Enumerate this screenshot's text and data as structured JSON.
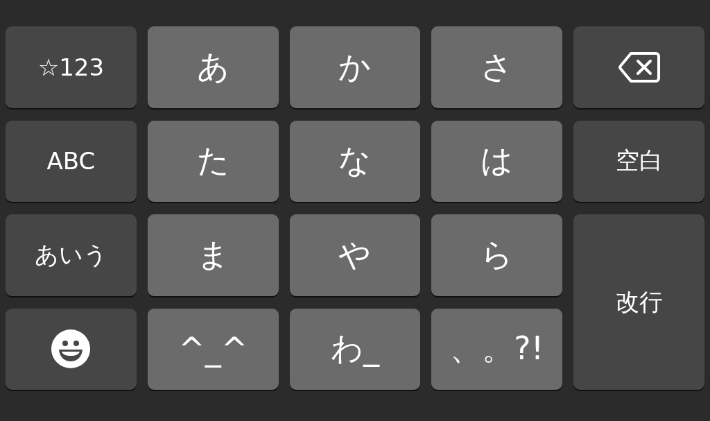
{
  "keys": [
    {
      "kind": "function",
      "label": "☆123"
    },
    {
      "kind": "char",
      "label": "あ"
    },
    {
      "kind": "char",
      "label": "か"
    },
    {
      "kind": "char",
      "label": "さ"
    },
    {
      "kind": "backspace"
    },
    {
      "kind": "function",
      "label": "ABC"
    },
    {
      "kind": "char",
      "label": "た"
    },
    {
      "kind": "char",
      "label": "な"
    },
    {
      "kind": "char",
      "label": "は"
    },
    {
      "kind": "function",
      "label": "空白"
    },
    {
      "kind": "function",
      "label": "あいう"
    },
    {
      "kind": "char",
      "label": "ま"
    },
    {
      "kind": "char",
      "label": "や"
    },
    {
      "kind": "char",
      "label": "ら"
    },
    {
      "kind": "return",
      "label": "改行"
    },
    {
      "kind": "emoji"
    },
    {
      "kind": "char",
      "label": "^_^"
    },
    {
      "kind": "char",
      "label": "わ_"
    },
    {
      "kind": "char",
      "label": "、。?!"
    }
  ]
}
